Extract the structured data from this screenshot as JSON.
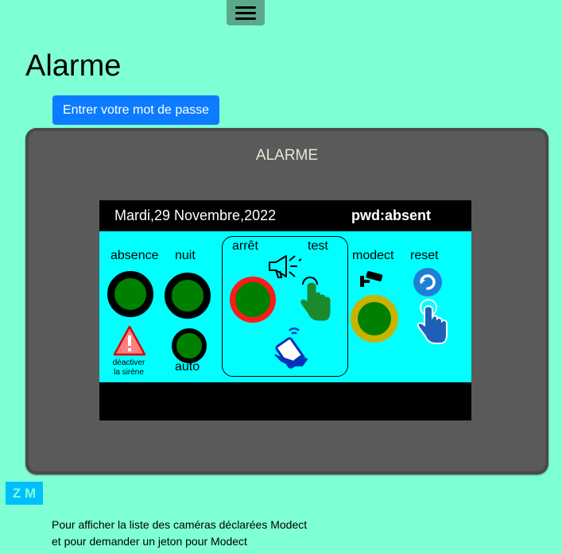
{
  "menu": {
    "icon": "hamburger-icon"
  },
  "page": {
    "title": "Alarme"
  },
  "password_button": {
    "label": "Entrer votre mot de passe"
  },
  "panel": {
    "title": "ALARME",
    "screen": {
      "date": "Mardi,29 Novembre,2022",
      "pwd_status": "pwd:absent",
      "labels": {
        "absence": "absence",
        "nuit": "nuit",
        "arret": "arrêt",
        "test": "test",
        "modect": "modect",
        "reset": "reset",
        "auto": "auto",
        "deactivate_line1": "déactiver",
        "deactivate_line2": "la sirène"
      },
      "colors": {
        "screen_bg": "#00ffff",
        "button_green": "#008000",
        "stop_ring": "#ff1a1a",
        "modect_ring": "#c8b400",
        "header_bg": "#000000"
      }
    }
  },
  "zm_button": {
    "label": "Z M"
  },
  "info": {
    "line1": "Pour afficher la liste des caméras déclarées Modect",
    "line2": "et pour demander un jeton pour Modect"
  }
}
